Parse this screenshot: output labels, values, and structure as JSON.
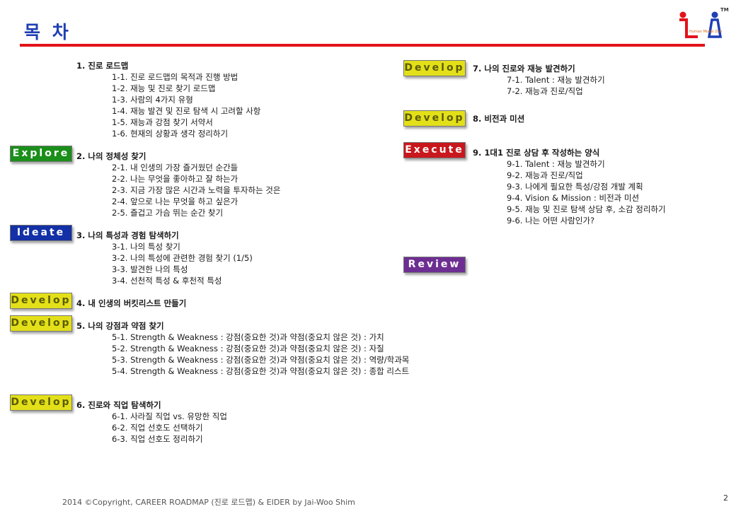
{
  "title": "목 차",
  "logo": {
    "tm": "TM",
    "tagline": "Human Model Zen"
  },
  "left_sections": [
    {
      "title": "1. 진로 로드맵",
      "items": [
        "1-1. 진로 로드맵의 목적과 진행 방법",
        "1-2. 재능 및 진로 찾기 로드맵",
        "1-3. 사람의 4가지 유형",
        "1-4. 재능 발견 및 진로 탐색 시 고려할 사항",
        "1-5. 재능과 강점 찾기 서약서",
        "1-6. 현재의 상황과 생각 정리하기"
      ]
    },
    {
      "badge": "Explore",
      "title": "2. 나의 정체성 찾기",
      "items": [
        "2-1. 내 인생의 가장 즐거웠던 순간들",
        "2-2. 나는 무엇을 좋아하고 잘 하는가",
        "2-3. 지금 가장 많은 시간과 노력을 투자하는 것은",
        "2-4. 앞으로 나는 무엇을 하고 싶은가",
        "2-5. 즐겁고 가슴 뛰는 순간 찾기"
      ]
    },
    {
      "badge": "Ideate",
      "title": "3. 나의 특성과 경험 탐색하기",
      "items": [
        "3-1. 나의 특성 찾기",
        "3-2. 나의 특성에 관련한 경험 찾기 (1/5)",
        "3-3. 발견한 나의 특성",
        "3-4. 선천적 특성 & 후천적 특성"
      ]
    },
    {
      "badge": "Develop",
      "title": "4. 내 인생의 버킷리스트 만들기",
      "items": []
    },
    {
      "badge": "Develop",
      "title": "5. 나의 강점과 약점 찾기",
      "items": [
        "5-1. Strength & Weakness : 강점(중요한 것)과 약점(중요치 않은 것) : 가치",
        "5-2. Strength & Weakness : 강점(중요한 것)과 약점(중요치 않은 것) : 자질",
        "5-3. Strength & Weakness : 강점(중요한 것)과 약점(중요치 않은 것) : 역량/학과목",
        "5-4. Strength & Weakness : 강점(중요한 것)과 약점(중요치 않은 것) : 종합 리스트"
      ]
    },
    {
      "badge": "Develop",
      "title": "6. 진로와 직업 탐색하기",
      "items": [
        "6-1. 사라질 직업 vs. 유망한 직업",
        "6-2. 직업 선호도 선택하기",
        "6-3. 직업 선호도 정리하기"
      ]
    }
  ],
  "right_sections": [
    {
      "badge": "Develop",
      "title": "7. 나의 진로와 재능 발견하기",
      "items": [
        "7-1. Talent : 재능 발견하기",
        "7-2. 재능과 진로/직업"
      ]
    },
    {
      "badge": "Develop",
      "title": "8. 비전과 미션",
      "items": []
    },
    {
      "badge": "Execute",
      "title": "9. 1대1 진로 상담 후 작성하는 양식",
      "items": [
        "9-1. Talent : 재능 발견하기",
        "9-2. 재능과 진로/직업",
        "9-3. 나에게 필요한 특성/강점 개발 계획",
        "9-4. Vision & Mission : 비전과 미션",
        "9-5. 재능 및 진로 탐색 상담 후, 소감 정리하기",
        "9-6. 나는 어떤 사람인가?"
      ]
    },
    {
      "badge": "Review",
      "title": "",
      "items": []
    }
  ],
  "footer": "2014 ©Copyright, CAREER ROADMAP (진로 로드맵) & EIDER by Jai-Woo Shim",
  "page_number": "2",
  "colors": {
    "title": "#1f3fb3",
    "rule": "#e3121b",
    "explore": "#1a8f1a",
    "ideate": "#1330a6",
    "develop": "#e3e01a",
    "execute": "#c8171d",
    "review": "#6d2e92"
  }
}
